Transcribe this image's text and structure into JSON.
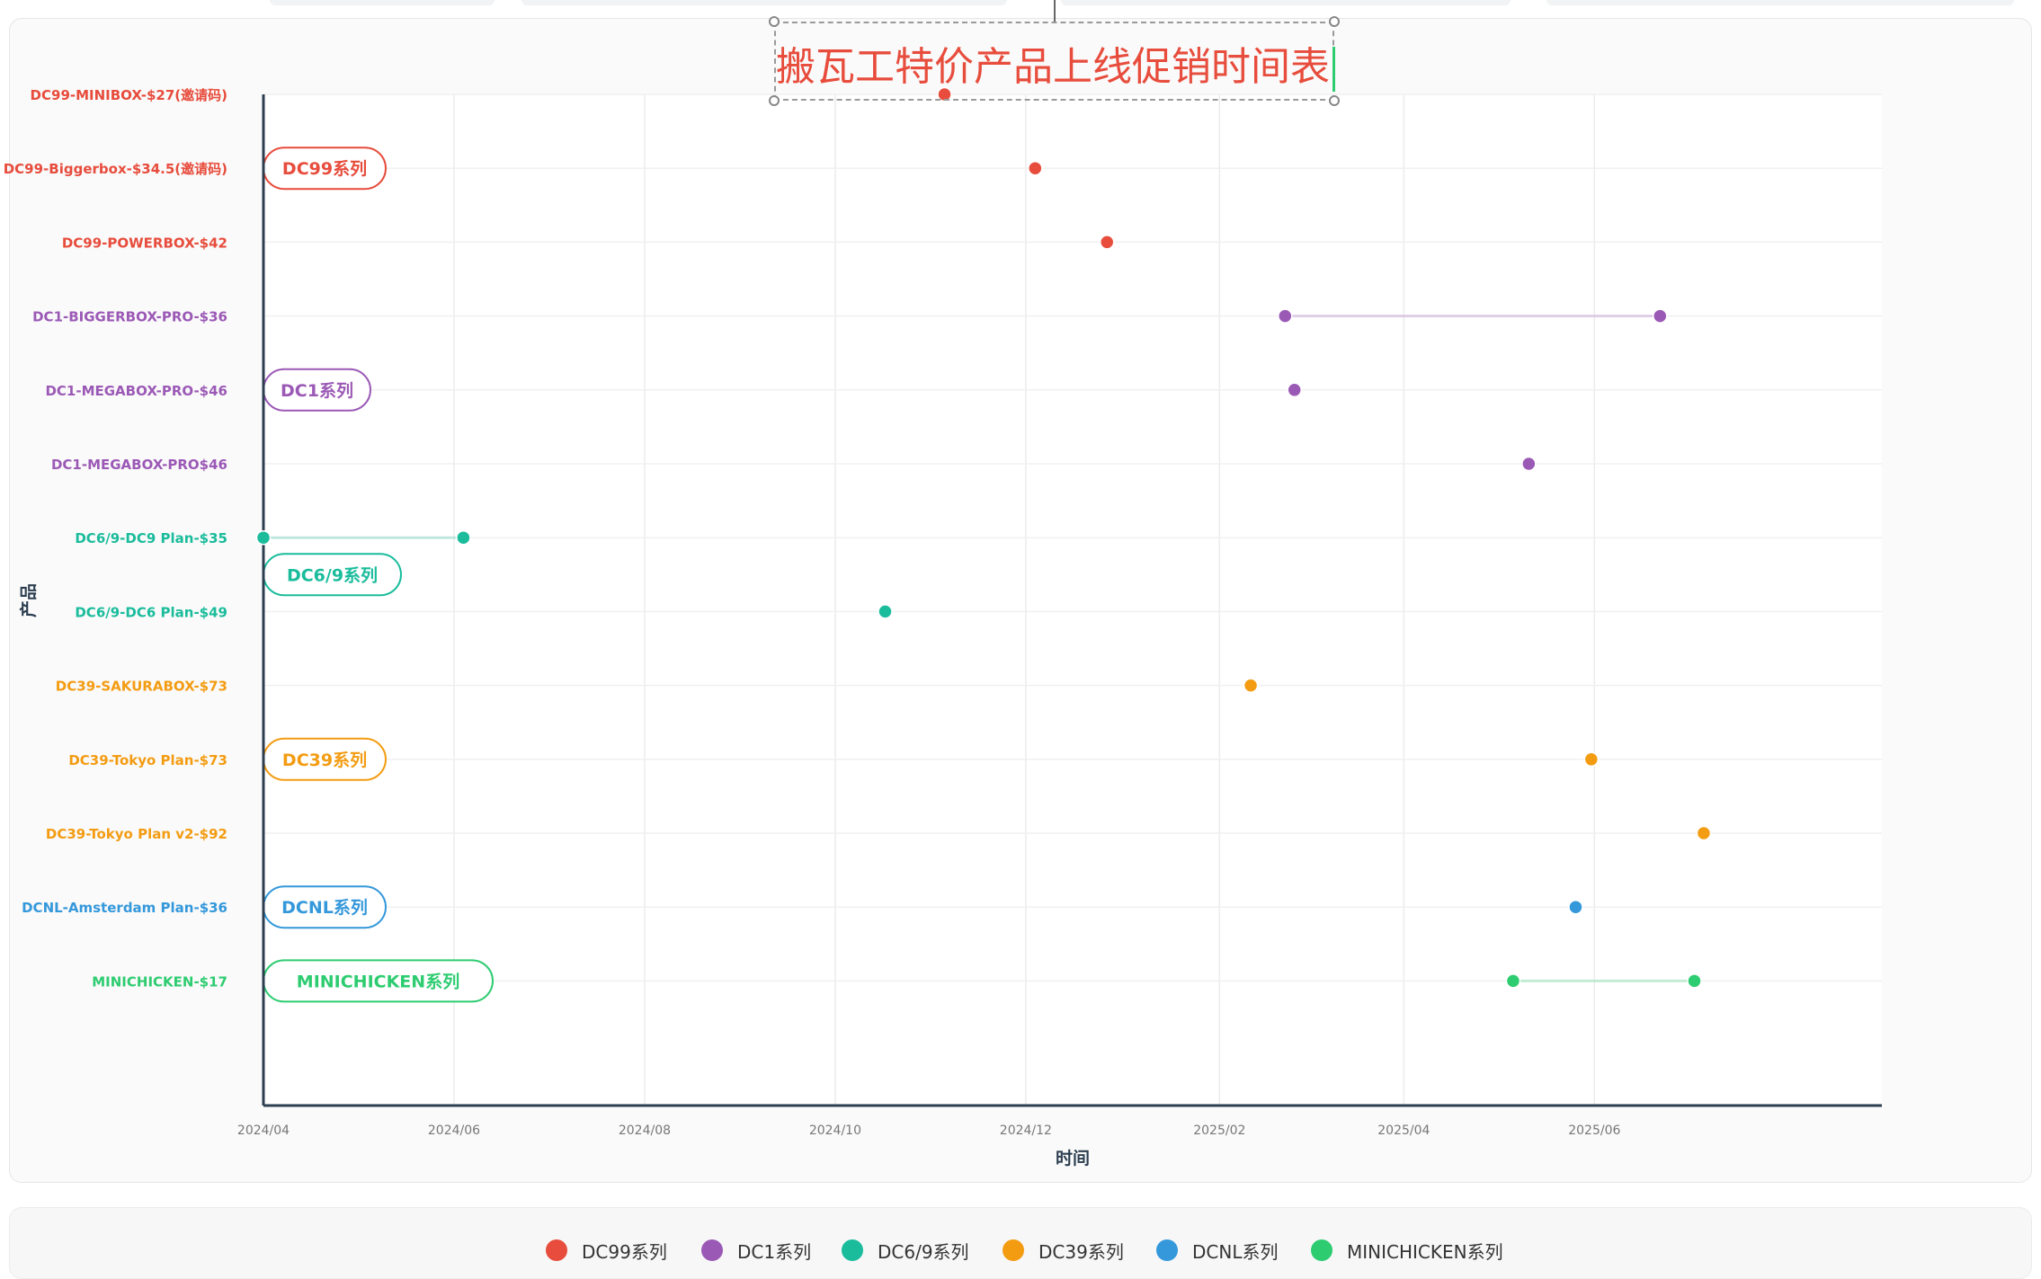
{
  "colors": {
    "dc99": "#e74c3c",
    "dc1": "#9b59b6",
    "dc69": "#1abc9c",
    "dc39": "#f39c12",
    "dcnl": "#3498db",
    "minichicken": "#2ecc71"
  },
  "chart_data": {
    "type": "scatter",
    "title": "搬瓦工特价产品上线促销时间表",
    "xlabel": "时间",
    "ylabel": "产品",
    "x_axis_type": "date",
    "xlim": [
      "2024-04-01",
      "2025-09-01"
    ],
    "x_ticks": [
      "2024/04",
      "2024/06",
      "2024/08",
      "2024/10",
      "2024/12",
      "2025/02",
      "2025/04",
      "2025/06"
    ],
    "grid": true,
    "legend_position": "bottom",
    "products": [
      {
        "label": "DC99-MINIBOX-$27(邀请码)",
        "group": "DC99系列",
        "dates": [
          "2024-11-05"
        ]
      },
      {
        "label": "DC99-Biggerbox-$34.5(邀请码)",
        "group": "DC99系列",
        "dates": [
          "2024-12-04"
        ]
      },
      {
        "label": "DC99-POWERBOX-$42",
        "group": "DC99系列",
        "dates": [
          "2024-12-27"
        ]
      },
      {
        "label": "DC1-BIGGERBOX-PRO-$36",
        "group": "DC1系列",
        "dates": [
          "2025-02-22",
          "2025-06-22"
        ]
      },
      {
        "label": "DC1-MEGABOX-PRO-$46",
        "group": "DC1系列",
        "dates": [
          "2025-02-25"
        ]
      },
      {
        "label": "DC1-MEGABOX-PRO$46",
        "group": "DC1系列",
        "dates": [
          "2025-05-11"
        ]
      },
      {
        "label": "DC6/9-DC9 Plan-$35",
        "group": "DC6/9系列",
        "dates": [
          "2024-04-01",
          "2024-06-04"
        ]
      },
      {
        "label": "DC6/9-DC6 Plan-$49",
        "group": "DC6/9系列",
        "dates": [
          "2024-10-17"
        ]
      },
      {
        "label": "DC39-SAKURABOX-$73",
        "group": "DC39系列",
        "dates": [
          "2025-02-11"
        ]
      },
      {
        "label": "DC39-Tokyo Plan-$73",
        "group": "DC39系列",
        "dates": [
          "2025-05-31"
        ]
      },
      {
        "label": "DC39-Tokyo Plan v2-$92",
        "group": "DC39系列",
        "dates": [
          "2025-07-06"
        ]
      },
      {
        "label": "DCNL-Amsterdam Plan-$36",
        "group": "DCNL系列",
        "dates": [
          "2025-05-26"
        ]
      },
      {
        "label": "MINICHICKEN-$17",
        "group": "MINICHICKEN系列",
        "dates": [
          "2025-05-06",
          "2025-07-03"
        ]
      }
    ],
    "groups": [
      {
        "name": "DC99系列",
        "color": "#e74c3c"
      },
      {
        "name": "DC1系列",
        "color": "#9b59b6"
      },
      {
        "name": "DC6/9系列",
        "color": "#1abc9c"
      },
      {
        "name": "DC39系列",
        "color": "#f39c12"
      },
      {
        "name": "DCNL系列",
        "color": "#3498db"
      },
      {
        "name": "MINICHICKEN系列",
        "color": "#2ecc71"
      }
    ]
  }
}
